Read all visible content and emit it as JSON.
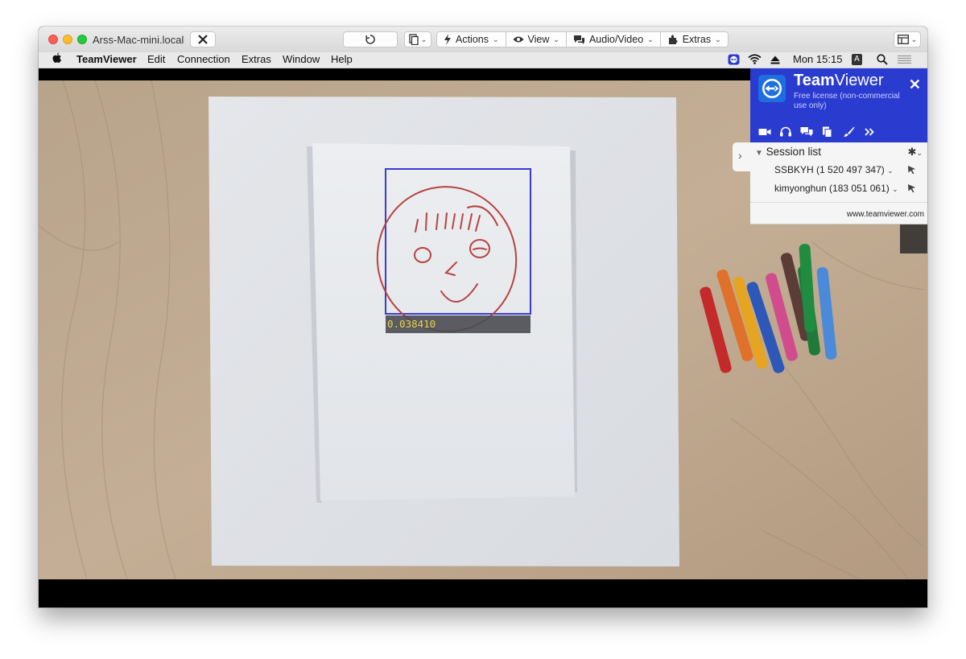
{
  "window": {
    "title": "Arss-Mac-mini.local"
  },
  "toolbar": {
    "actions_label": "Actions",
    "view_label": "View",
    "audio_video_label": "Audio/Video",
    "extras_label": "Extras"
  },
  "menubar": {
    "app_name": "TeamViewer",
    "items": [
      "Edit",
      "Connection",
      "Extras",
      "Window",
      "Help"
    ],
    "clock": "Mon 15:15",
    "input_indicator": "A"
  },
  "detection": {
    "score_label": "0.038410"
  },
  "teamviewer_panel": {
    "brand_bold": "Team",
    "brand_light": "Viewer",
    "license_text": "Free license (non-commercial use only)",
    "session_list_label": "Session list",
    "sessions": [
      {
        "label": "SSBKYH (1 520 497 347)"
      },
      {
        "label": "kimyonghun (183 051 061)"
      }
    ],
    "url": "www.teamviewer.com"
  },
  "colors": {
    "teamviewer_blue": "#2a3bd0",
    "detection_box": "#3a3ad8",
    "score_text": "#e6d24a"
  },
  "icons": {
    "toolbar": [
      "close-icon",
      "refresh-icon",
      "clipboard-icon",
      "lightning-icon",
      "eye-icon",
      "chat-icon",
      "puzzle-icon",
      "sidebar-icon"
    ],
    "panel": [
      "video-icon",
      "headset-icon",
      "chat-icon",
      "files-icon",
      "brush-icon",
      "more-icon"
    ]
  }
}
